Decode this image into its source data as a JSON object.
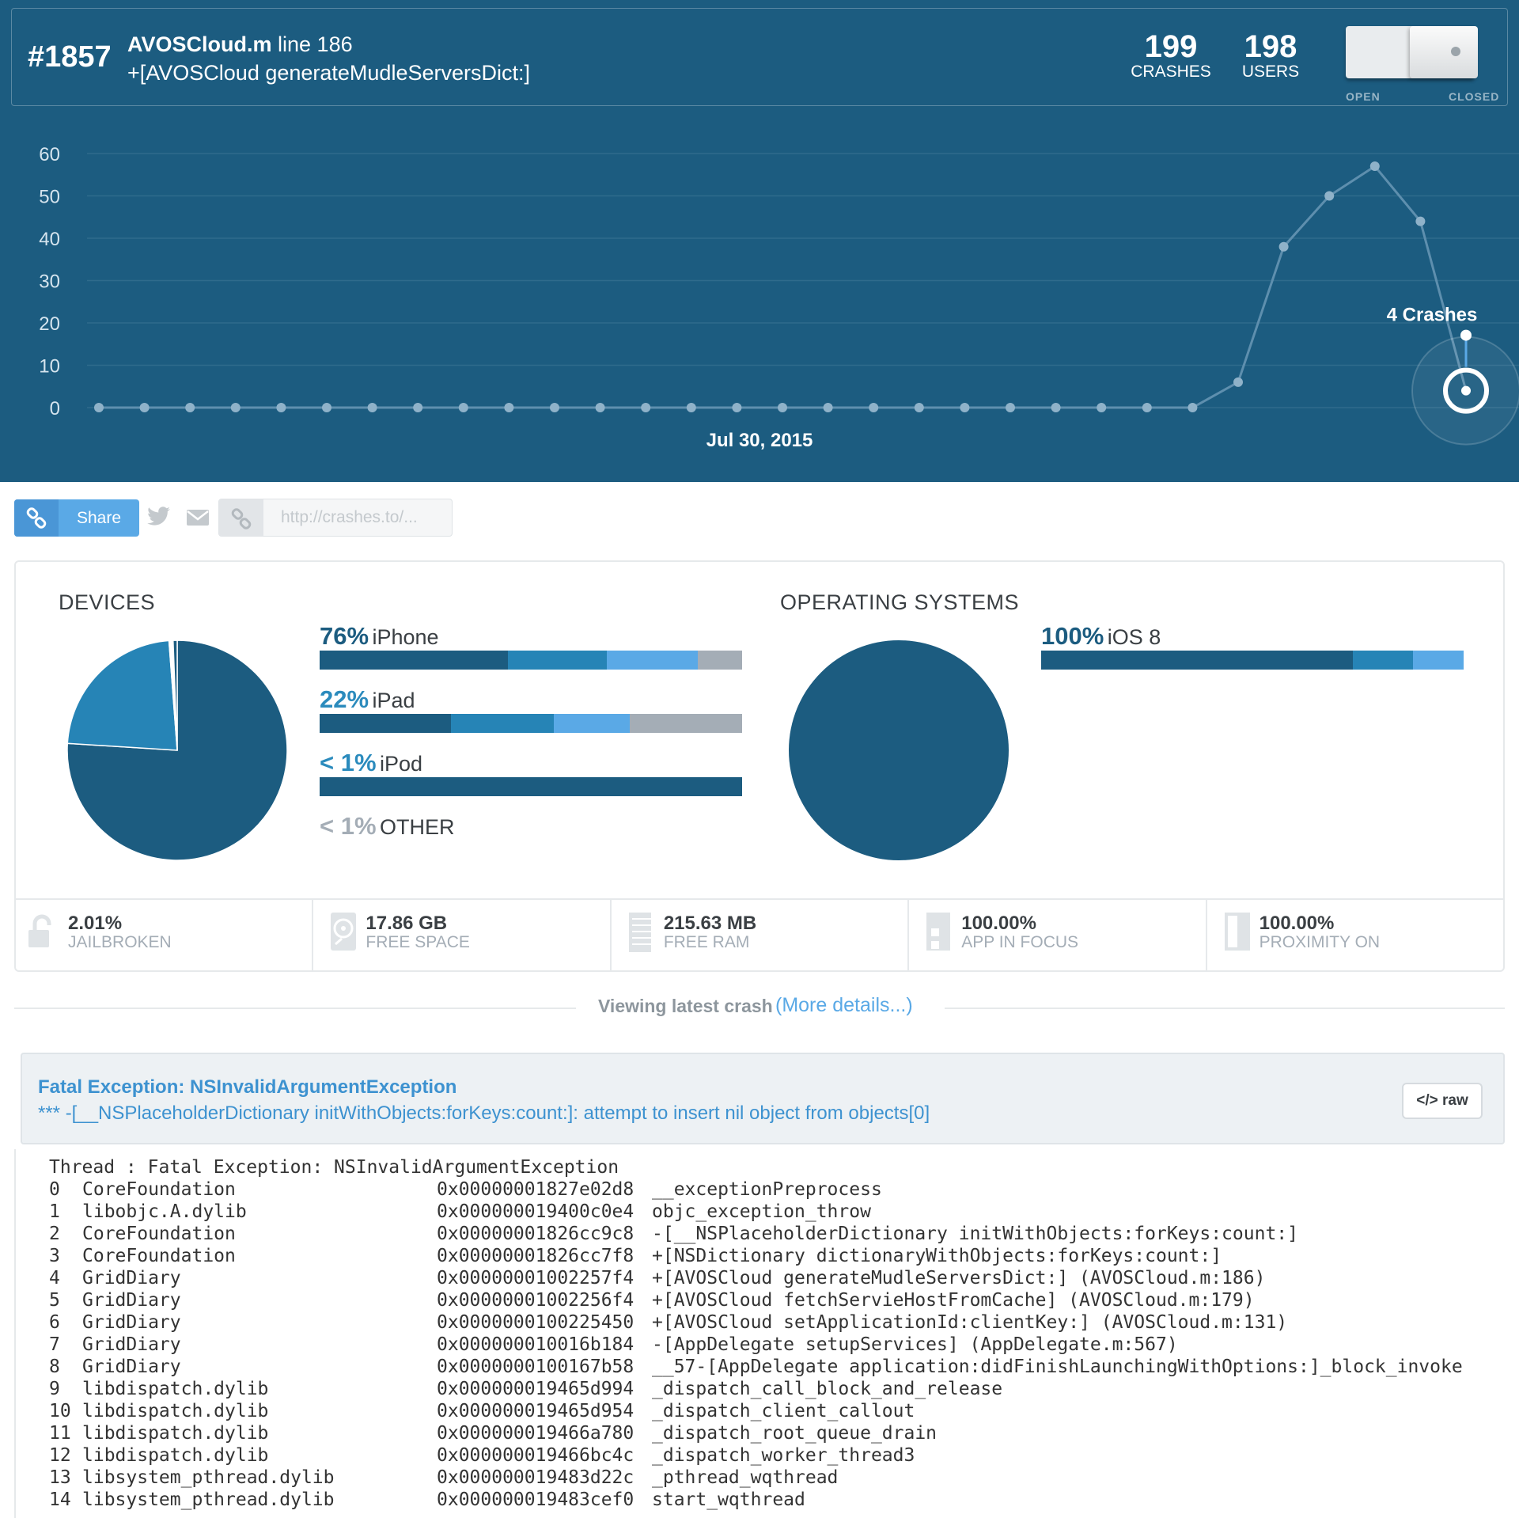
{
  "issue": {
    "number": "#1857",
    "file": "AVOSCloud.m",
    "line": " line 186",
    "method": "+[AVOSCloud generateMudleServersDict:]"
  },
  "stats": {
    "crashes_value": "199",
    "crashes_label": "CRASHES",
    "users_value": "198",
    "users_label": "USERS"
  },
  "status_toggle": {
    "open_label": "OPEN",
    "closed_label": "CLOSED",
    "state": "closed"
  },
  "chart_data": {
    "type": "line",
    "y_ticks": [
      "60",
      "50",
      "40",
      "30",
      "20",
      "10",
      "0"
    ],
    "ylim": [
      0,
      60
    ],
    "x_label": "Jul 30, 2015",
    "values": [
      0,
      0,
      0,
      0,
      0,
      0,
      0,
      0,
      0,
      0,
      0,
      0,
      0,
      0,
      0,
      0,
      0,
      0,
      0,
      0,
      0,
      0,
      0,
      0,
      0,
      6,
      38,
      50,
      57,
      44,
      4
    ],
    "highlight_index": 30,
    "highlight_label": "4 Crashes",
    "grid": true,
    "colors": {
      "line": "#5e8fae",
      "point": "#8fb2c9",
      "grid": "#2f6b8c"
    }
  },
  "share": {
    "button_label": "Share",
    "url_placeholder": "http://crashes.to/..."
  },
  "devices": {
    "title": "DEVICES",
    "pie": [
      {
        "name": "iPhone",
        "value": 76,
        "color": "#1c5c80"
      },
      {
        "name": "iPad",
        "value": 22.8,
        "color": "#2684b6"
      },
      {
        "name": "iPod",
        "value": 0.6,
        "color": "#ffffff"
      },
      {
        "name": "OTHER",
        "value": 0.6,
        "color": "#1c5c80"
      }
    ],
    "rows": [
      {
        "pct": "76%",
        "name": "iPhone",
        "segments": [
          {
            "fraction": 0.445,
            "color": "#1c5c80"
          },
          {
            "fraction": 0.235,
            "color": "#2684b6"
          },
          {
            "fraction": 0.215,
            "color": "#5aa9e6"
          },
          {
            "fraction": 0.105,
            "color": "#a4adb6"
          }
        ]
      },
      {
        "pct": "22%",
        "name": "iPad",
        "segments": [
          {
            "fraction": 0.31,
            "color": "#1c5c80"
          },
          {
            "fraction": 0.245,
            "color": "#2684b6"
          },
          {
            "fraction": 0.18,
            "color": "#5aa9e6"
          },
          {
            "fraction": 0.265,
            "color": "#a4adb6"
          }
        ]
      },
      {
        "pct": "< 1%",
        "name": "iPod",
        "segments": [
          {
            "fraction": 1.0,
            "color": "#1c5c80"
          }
        ]
      },
      {
        "pct": "< 1%",
        "name": "OTHER",
        "segments": []
      }
    ]
  },
  "operating_systems": {
    "title": "OPERATING SYSTEMS",
    "pie": [
      {
        "name": "iOS 8",
        "value": 100,
        "color": "#1c5c80"
      }
    ],
    "rows": [
      {
        "pct": "100%",
        "name": "iOS 8",
        "segments": [
          {
            "fraction": 0.738,
            "color": "#1c5c80"
          },
          {
            "fraction": 0.142,
            "color": "#2684b6"
          },
          {
            "fraction": 0.12,
            "color": "#5aa9e6"
          }
        ]
      }
    ]
  },
  "device_stats": [
    {
      "value": "2.01%",
      "label": "JAILBROKEN",
      "icon": "unlock-icon"
    },
    {
      "value": "17.86 GB",
      "label": "FREE SPACE",
      "icon": "disk-icon"
    },
    {
      "value": "215.63 MB",
      "label": "FREE RAM",
      "icon": "ram-icon"
    },
    {
      "value": "100.00%",
      "label": "APP IN FOCUS",
      "icon": "app-focus-icon"
    },
    {
      "value": "100.00%",
      "label": "PROXIMITY ON",
      "icon": "proximity-icon"
    }
  ],
  "viewing": {
    "text": "Viewing latest crash",
    "link": "(More details...)"
  },
  "exception": {
    "title": "Fatal Exception: NSInvalidArgumentException",
    "message": "*** -[__NSPlaceholderDictionary initWithObjects:forKeys:count:]: attempt to insert nil object from objects[0]",
    "raw_label": "raw"
  },
  "stacktrace": {
    "header": "Thread : Fatal Exception: NSInvalidArgumentException",
    "frames": [
      {
        "index": "0",
        "library": "CoreFoundation",
        "address": "0x00000001827e02d8",
        "symbol": "__exceptionPreprocess"
      },
      {
        "index": "1",
        "library": "libobjc.A.dylib",
        "address": "0x000000019400c0e4",
        "symbol": "objc_exception_throw"
      },
      {
        "index": "2",
        "library": "CoreFoundation",
        "address": "0x00000001826cc9c8",
        "symbol": "-[__NSPlaceholderDictionary initWithObjects:forKeys:count:]"
      },
      {
        "index": "3",
        "library": "CoreFoundation",
        "address": "0x00000001826cc7f8",
        "symbol": "+[NSDictionary dictionaryWithObjects:forKeys:count:]"
      },
      {
        "index": "4",
        "library": "GridDiary",
        "address": "0x00000001002257f4",
        "symbol": "+[AVOSCloud generateMudleServersDict:] (AVOSCloud.m:186)"
      },
      {
        "index": "5",
        "library": "GridDiary",
        "address": "0x00000001002256f4",
        "symbol": "+[AVOSCloud fetchServieHostFromCache] (AVOSCloud.m:179)"
      },
      {
        "index": "6",
        "library": "GridDiary",
        "address": "0x0000000100225450",
        "symbol": "+[AVOSCloud setApplicationId:clientKey:] (AVOSCloud.m:131)"
      },
      {
        "index": "7",
        "library": "GridDiary",
        "address": "0x000000010016b184",
        "symbol": "-[AppDelegate setupServices] (AppDelegate.m:567)"
      },
      {
        "index": "8",
        "library": "GridDiary",
        "address": "0x0000000100167b58",
        "symbol": "__57-[AppDelegate application:didFinishLaunchingWithOptions:]_block_invoke"
      },
      {
        "index": "9",
        "library": "libdispatch.dylib",
        "address": "0x000000019465d994",
        "symbol": "_dispatch_call_block_and_release"
      },
      {
        "index": "10",
        "library": "libdispatch.dylib",
        "address": "0x000000019465d954",
        "symbol": "_dispatch_client_callout"
      },
      {
        "index": "11",
        "library": "libdispatch.dylib",
        "address": "0x000000019466a780",
        "symbol": "_dispatch_root_queue_drain"
      },
      {
        "index": "12",
        "library": "libdispatch.dylib",
        "address": "0x000000019466bc4c",
        "symbol": "_dispatch_worker_thread3"
      },
      {
        "index": "13",
        "library": "libsystem_pthread.dylib",
        "address": "0x000000019483d22c",
        "symbol": "_pthread_wqthread"
      },
      {
        "index": "14",
        "library": "libsystem_pthread.dylib",
        "address": "0x000000019483cef0",
        "symbol": "start_wqthread"
      }
    ]
  }
}
